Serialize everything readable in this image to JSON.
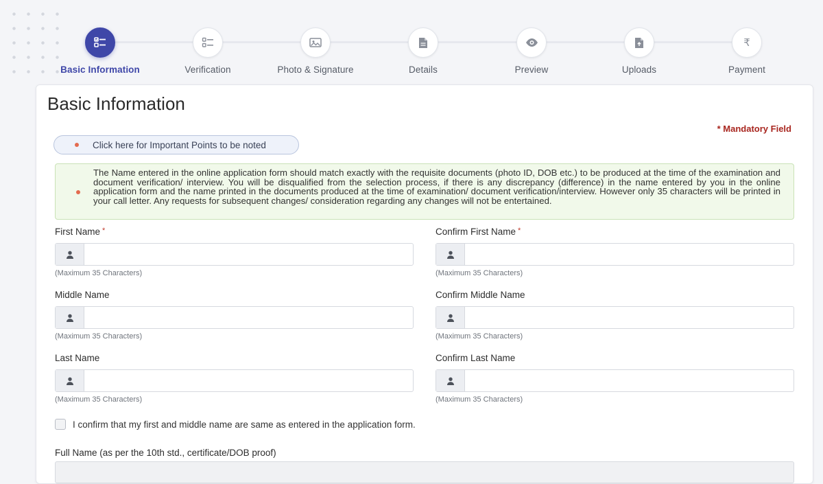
{
  "stepper": {
    "steps": [
      {
        "label": "Basic Information",
        "icon": "checklist-icon",
        "active": true
      },
      {
        "label": "Verification",
        "icon": "list-check-icon",
        "active": false
      },
      {
        "label": "Photo & Signature",
        "icon": "image-icon",
        "active": false
      },
      {
        "label": "Details",
        "icon": "document-icon",
        "active": false
      },
      {
        "label": "Preview",
        "icon": "eye-icon",
        "active": false
      },
      {
        "label": "Uploads",
        "icon": "upload-file-icon",
        "active": false
      },
      {
        "label": "Payment",
        "icon": "rupee-icon",
        "active": false
      }
    ],
    "payment_symbol": "₹"
  },
  "page": {
    "title": "Basic Information",
    "mandatory_note": "* Mandatory Field",
    "important_points_label": "Click here for Important Points to be noted",
    "notice_text": "The Name entered in the online application form should match exactly with the requisite documents (photo ID, DOB etc.) to be produced at the time of the examination and document verification/ interview. You will be disqualified from the selection process, if there is any discrepancy (difference) in the name entered by you in the online application form and the name printed in the documents produced at the time of examination/ document verification/interview. However only 35 characters will be printed in your call letter. Any requests for subsequent changes/ consideration regarding any changes will not be entertained."
  },
  "form": {
    "first_name": {
      "label": "First Name",
      "required_mark": "*",
      "value": "",
      "hint": "(Maximum 35 Characters)"
    },
    "confirm_first_name": {
      "label": "Confirm First Name",
      "required_mark": "*",
      "value": "",
      "hint": "(Maximum 35 Characters)"
    },
    "middle_name": {
      "label": "Middle Name",
      "value": "",
      "hint": "(Maximum 35 Characters)"
    },
    "confirm_middle_name": {
      "label": "Confirm Middle Name",
      "value": "",
      "hint": "(Maximum 35 Characters)"
    },
    "last_name": {
      "label": "Last Name",
      "value": "",
      "hint": "(Maximum 35 Characters)"
    },
    "confirm_last_name": {
      "label": "Confirm Last Name",
      "value": "",
      "hint": "(Maximum 35 Characters)"
    },
    "confirm_checkbox_label": "I confirm that my first and middle name are same as entered in the application form.",
    "full_name_label": "Full Name (as per the 10th std., certificate/DOB proof)"
  },
  "colors": {
    "accent": "#3f47a8",
    "mandatory": "#a8261f",
    "notice_bg": "#f1f9ea"
  }
}
